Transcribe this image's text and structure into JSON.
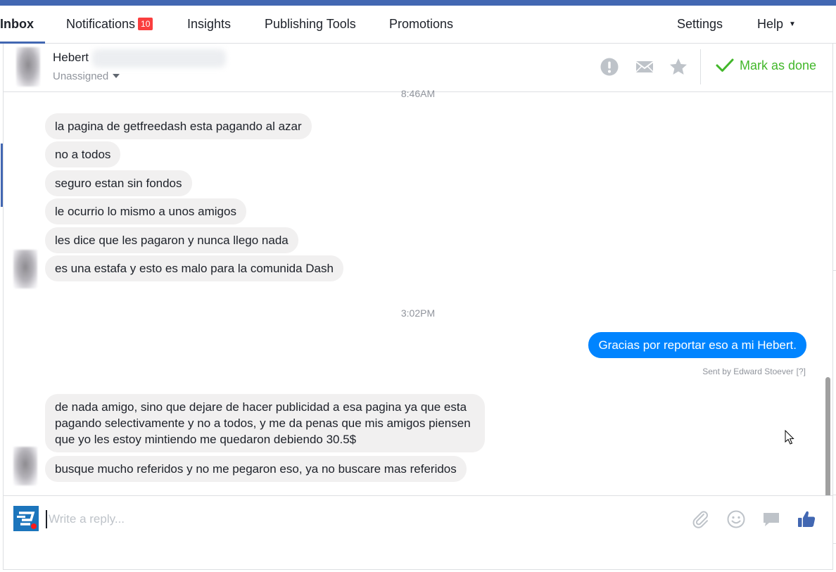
{
  "nav": {
    "inbox": "Inbox",
    "notifications": "Notifications",
    "notifications_count": "10",
    "insights": "Insights",
    "publishing_tools": "Publishing Tools",
    "promotions": "Promotions",
    "settings": "Settings",
    "help": "Help"
  },
  "conversation": {
    "contact_name": "Hebert",
    "assignment": "Unassigned",
    "mark_done": "Mark as done",
    "icons": [
      "report-icon",
      "mail-icon",
      "star-icon",
      "checkmark-icon"
    ]
  },
  "thread": {
    "timestamp_top": "8:46AM",
    "incoming_1": [
      "la pagina de getfreedash esta pagando al azar",
      "no a todos",
      "seguro estan sin fondos",
      "le ocurrio lo mismo a unos amigos",
      "les dice que les pagaron y nunca llego nada",
      "es una estafa y esto es malo para la comunida Dash"
    ],
    "timestamp_mid": "3:02PM",
    "outgoing": "Gracias por reportar eso a mi Hebert.",
    "sent_by": "Sent by Edward Stoever",
    "sent_by_help": "[?]",
    "incoming_2": [
      "de nada amigo, sino que dejare de hacer publicidad a esa pagina ya que esta pagando selectivamente y no a todos, y me da penas que mis amigos piensen que yo les estoy mintiendo me quedaron debiendo 30.5$",
      "busque mucho referidos y no me pegaron eso, ya no buscare mas referidos"
    ]
  },
  "composer": {
    "placeholder": "Write a reply...",
    "icons": [
      "attachment-icon",
      "emoji-icon",
      "sticker-icon",
      "like-icon"
    ]
  },
  "colors": {
    "brand": "#4267b2",
    "outgoing_bubble": "#0084ff",
    "incoming_bubble": "#f1f0f0",
    "done_green": "#42b72a",
    "badge_red": "#fa3e3e"
  }
}
